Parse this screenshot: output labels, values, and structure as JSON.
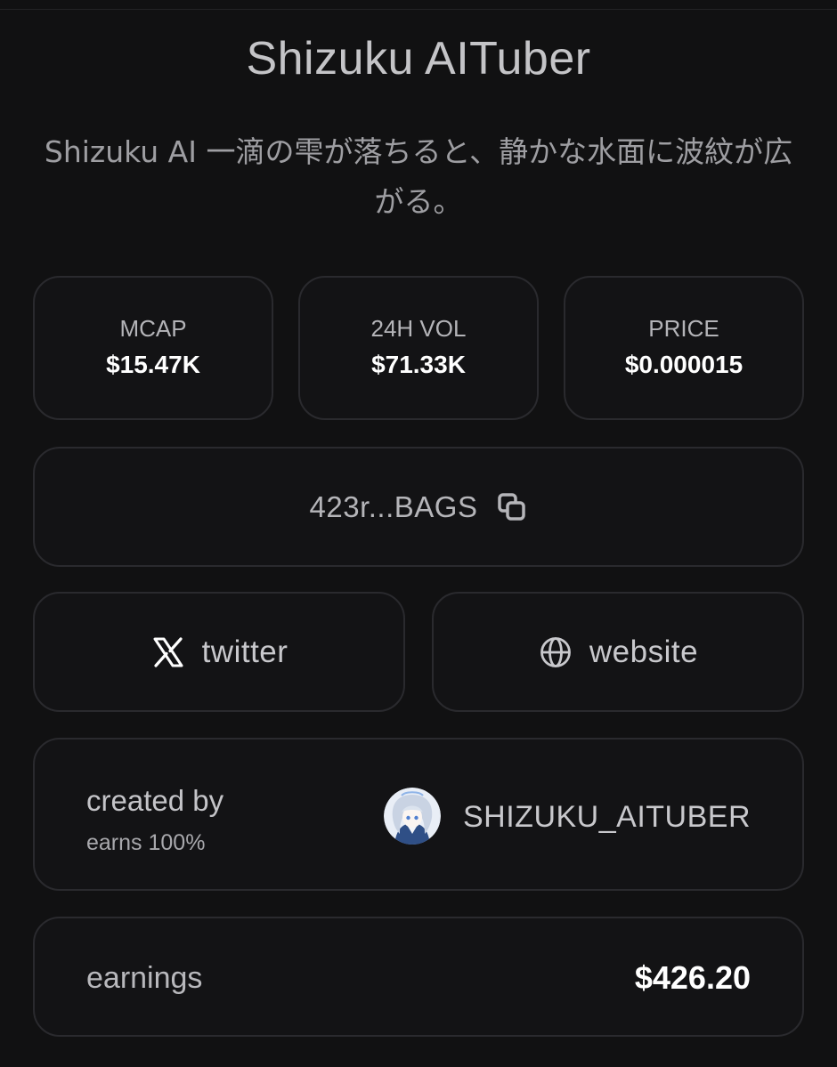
{
  "header": {
    "title": "Shizuku AITuber",
    "description": "Shizuku AI 一滴の雫が落ちると、静かな水面に波紋が広がる。"
  },
  "stats": [
    {
      "label": "MCAP",
      "value": "$15.47K"
    },
    {
      "label": "24H VOL",
      "value": "$71.33K"
    },
    {
      "label": "PRICE",
      "value": "$0.000015"
    }
  ],
  "contract": {
    "address": "423r...BAGS",
    "icon": "copy-icon"
  },
  "links": [
    {
      "label": "twitter",
      "icon": "x-logo-icon"
    },
    {
      "label": "website",
      "icon": "globe-icon"
    }
  ],
  "creator": {
    "label": "created by",
    "sub_label": "earns 100%",
    "name": "SHIZUKU_AITUBER"
  },
  "earnings": {
    "label": "earnings",
    "value": "$426.20"
  }
}
